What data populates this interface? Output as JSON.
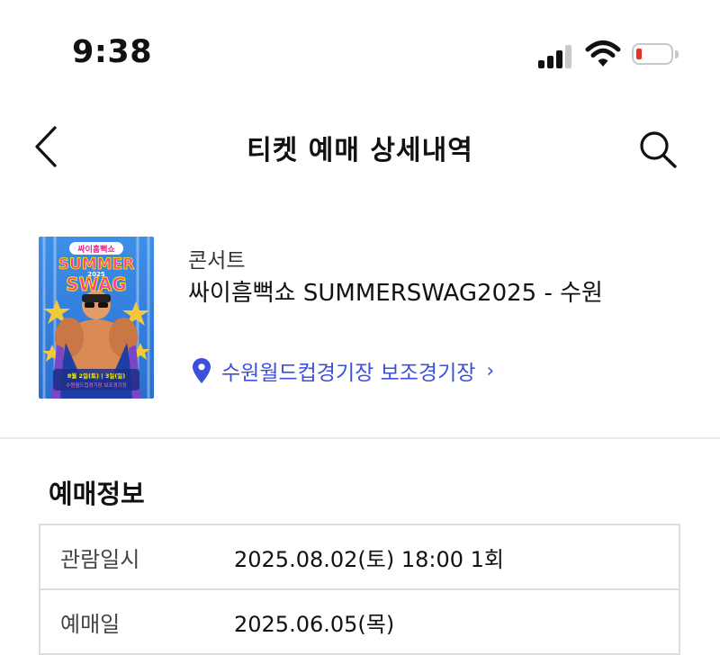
{
  "status_bar": {
    "time": "9:38",
    "icons": [
      "cellular-signal-icon",
      "wifi-icon",
      "battery-low-icon"
    ],
    "battery_color": "#e5332a"
  },
  "header": {
    "title": "티켓 예매 상세내역",
    "back_icon": "chevron-left-icon",
    "search_icon": "search-icon"
  },
  "event": {
    "category": "콘서트",
    "title": "싸이흠뻑쇼 SUMMERSWAG2025 - 수원",
    "venue": "수원월드컵경기장 보조경기장",
    "venue_chevron": "›",
    "venue_color": "#3c50dc",
    "poster": {
      "badge": "싸이흠뻑쇼",
      "line1": "SUMMER",
      "line2": "2025",
      "line3": "SWAG",
      "date_text": "8월 2일(토) | 3일(일)",
      "place_text": "수원월드컵경기장 보조경기장"
    }
  },
  "booking_info": {
    "section_title": "예매정보",
    "rows": [
      {
        "label": "관람일시",
        "value": "2025.08.02(토) 18:00 1회"
      },
      {
        "label": "예매일",
        "value": "2025.06.05(목)"
      }
    ]
  }
}
